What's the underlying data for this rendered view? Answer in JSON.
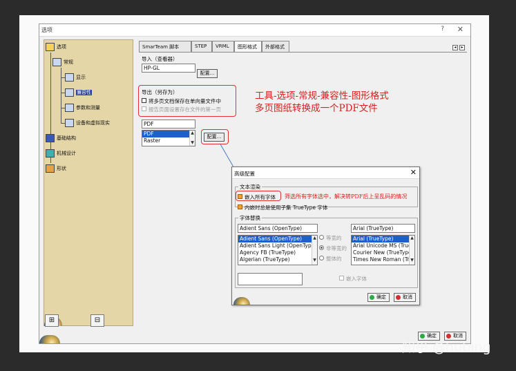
{
  "window": {
    "title": "选项",
    "help": "?",
    "close": "✕"
  },
  "tree": {
    "root": "选项",
    "items": [
      "常规",
      "显示",
      "兼容性",
      "参数和测量",
      "设备和虚拟现实",
      "基础结构",
      "机械设计",
      "形状"
    ]
  },
  "tabs": [
    "SmarTeam 脚本",
    "STEP",
    "VRML",
    "图形格式",
    "外部格式"
  ],
  "import": {
    "label": "导入（查看器）",
    "value": "HP-GL",
    "config": "配置..."
  },
  "export": {
    "label": "导出（另存为）",
    "multi_page": "将多页文档保存在单向量文件中",
    "save_hidden": "报告页面设置存在文件的第一页",
    "format_value": "PDF",
    "formats": [
      "PDF",
      "Raster"
    ],
    "config": "配置..."
  },
  "annotation": {
    "line1": "工具-选项-常规-兼容性-图形格式",
    "line2": "多页图纸转换成一个PDF文件",
    "embed_note": "筛选所有字体选中，解决转PDF后上呈乱码的情况"
  },
  "dialog": {
    "title": "高级配置",
    "close": "✕",
    "text_group": "文本渲染",
    "embed_all": "嵌入所有字体",
    "truetype_subset": "内嵌时总是使用子集 TrueType 字体",
    "font_group": "字体替换",
    "left_fonts_header": "Adient Sans (OpenType)",
    "left_fonts": [
      "Adient Sans (OpenType)",
      "Adient Sans Light (OpenType)",
      "Agency FB (TrueType)",
      "Algerian (TrueType)"
    ],
    "right_fonts_header": "Arial (TrueType)",
    "right_fonts": [
      "Arial (TrueType)",
      "Arial Unicode MS (TrueType)",
      "Courier New (TrueType)",
      "Times New Roman (TrueType)"
    ],
    "radio_options": [
      "等宽的",
      "非等宽的",
      "整体的"
    ],
    "embed_font": "嵌入字体",
    "ok": "确定",
    "cancel": "取消"
  },
  "main_buttons": {
    "ok": "确定",
    "cancel": "取消"
  },
  "watermark": "知乎 @hubing",
  "colors": {
    "tree_bg": "#e5d6a8",
    "selection": "#1e3f9a",
    "annotation_red": "#d82020"
  }
}
